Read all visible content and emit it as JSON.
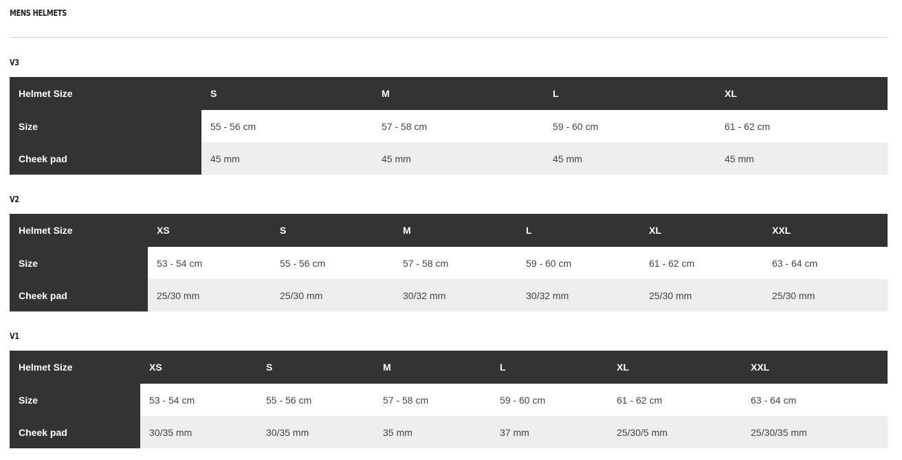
{
  "page": {
    "title": "MENS HELMETS"
  },
  "tables": [
    {
      "title": "V3",
      "header_label": "Helmet Size",
      "sizes": [
        "S",
        "M",
        "L",
        "XL"
      ],
      "rows": [
        {
          "label": "Size",
          "values": [
            "55 - 56 cm",
            "57 - 58 cm",
            "59 - 60 cm",
            "61 - 62 cm"
          ]
        },
        {
          "label": "Cheek pad",
          "values": [
            "45 mm",
            "45 mm",
            "45 mm",
            "45 mm"
          ]
        }
      ]
    },
    {
      "title": "V2",
      "header_label": "Helmet Size",
      "sizes": [
        "XS",
        "S",
        "M",
        "L",
        "XL",
        "XXL"
      ],
      "rows": [
        {
          "label": "Size",
          "values": [
            "53 - 54 cm",
            "55 - 56 cm",
            "57 - 58 cm",
            "59 - 60 cm",
            "61 - 62 cm",
            "63 - 64 cm"
          ]
        },
        {
          "label": "Cheek pad",
          "values": [
            "25/30 mm",
            "25/30 mm",
            "30/32 mm",
            "30/32 mm",
            "25/30 mm",
            "25/30 mm"
          ]
        }
      ]
    },
    {
      "title": "V1",
      "header_label": "Helmet Size",
      "sizes": [
        "XS",
        "S",
        "M",
        "L",
        "XL",
        "XXL"
      ],
      "rows": [
        {
          "label": "Size",
          "values": [
            "53 - 54 cm",
            "55 - 56 cm",
            "57 - 58 cm",
            "59 - 60 cm",
            "61 - 62 cm",
            "63 - 64 cm"
          ]
        },
        {
          "label": "Cheek pad",
          "values": [
            "30/35 mm",
            "30/35 mm",
            "35 mm",
            "37 mm",
            "25/30/5 mm",
            "25/30/35 mm"
          ]
        }
      ]
    }
  ]
}
